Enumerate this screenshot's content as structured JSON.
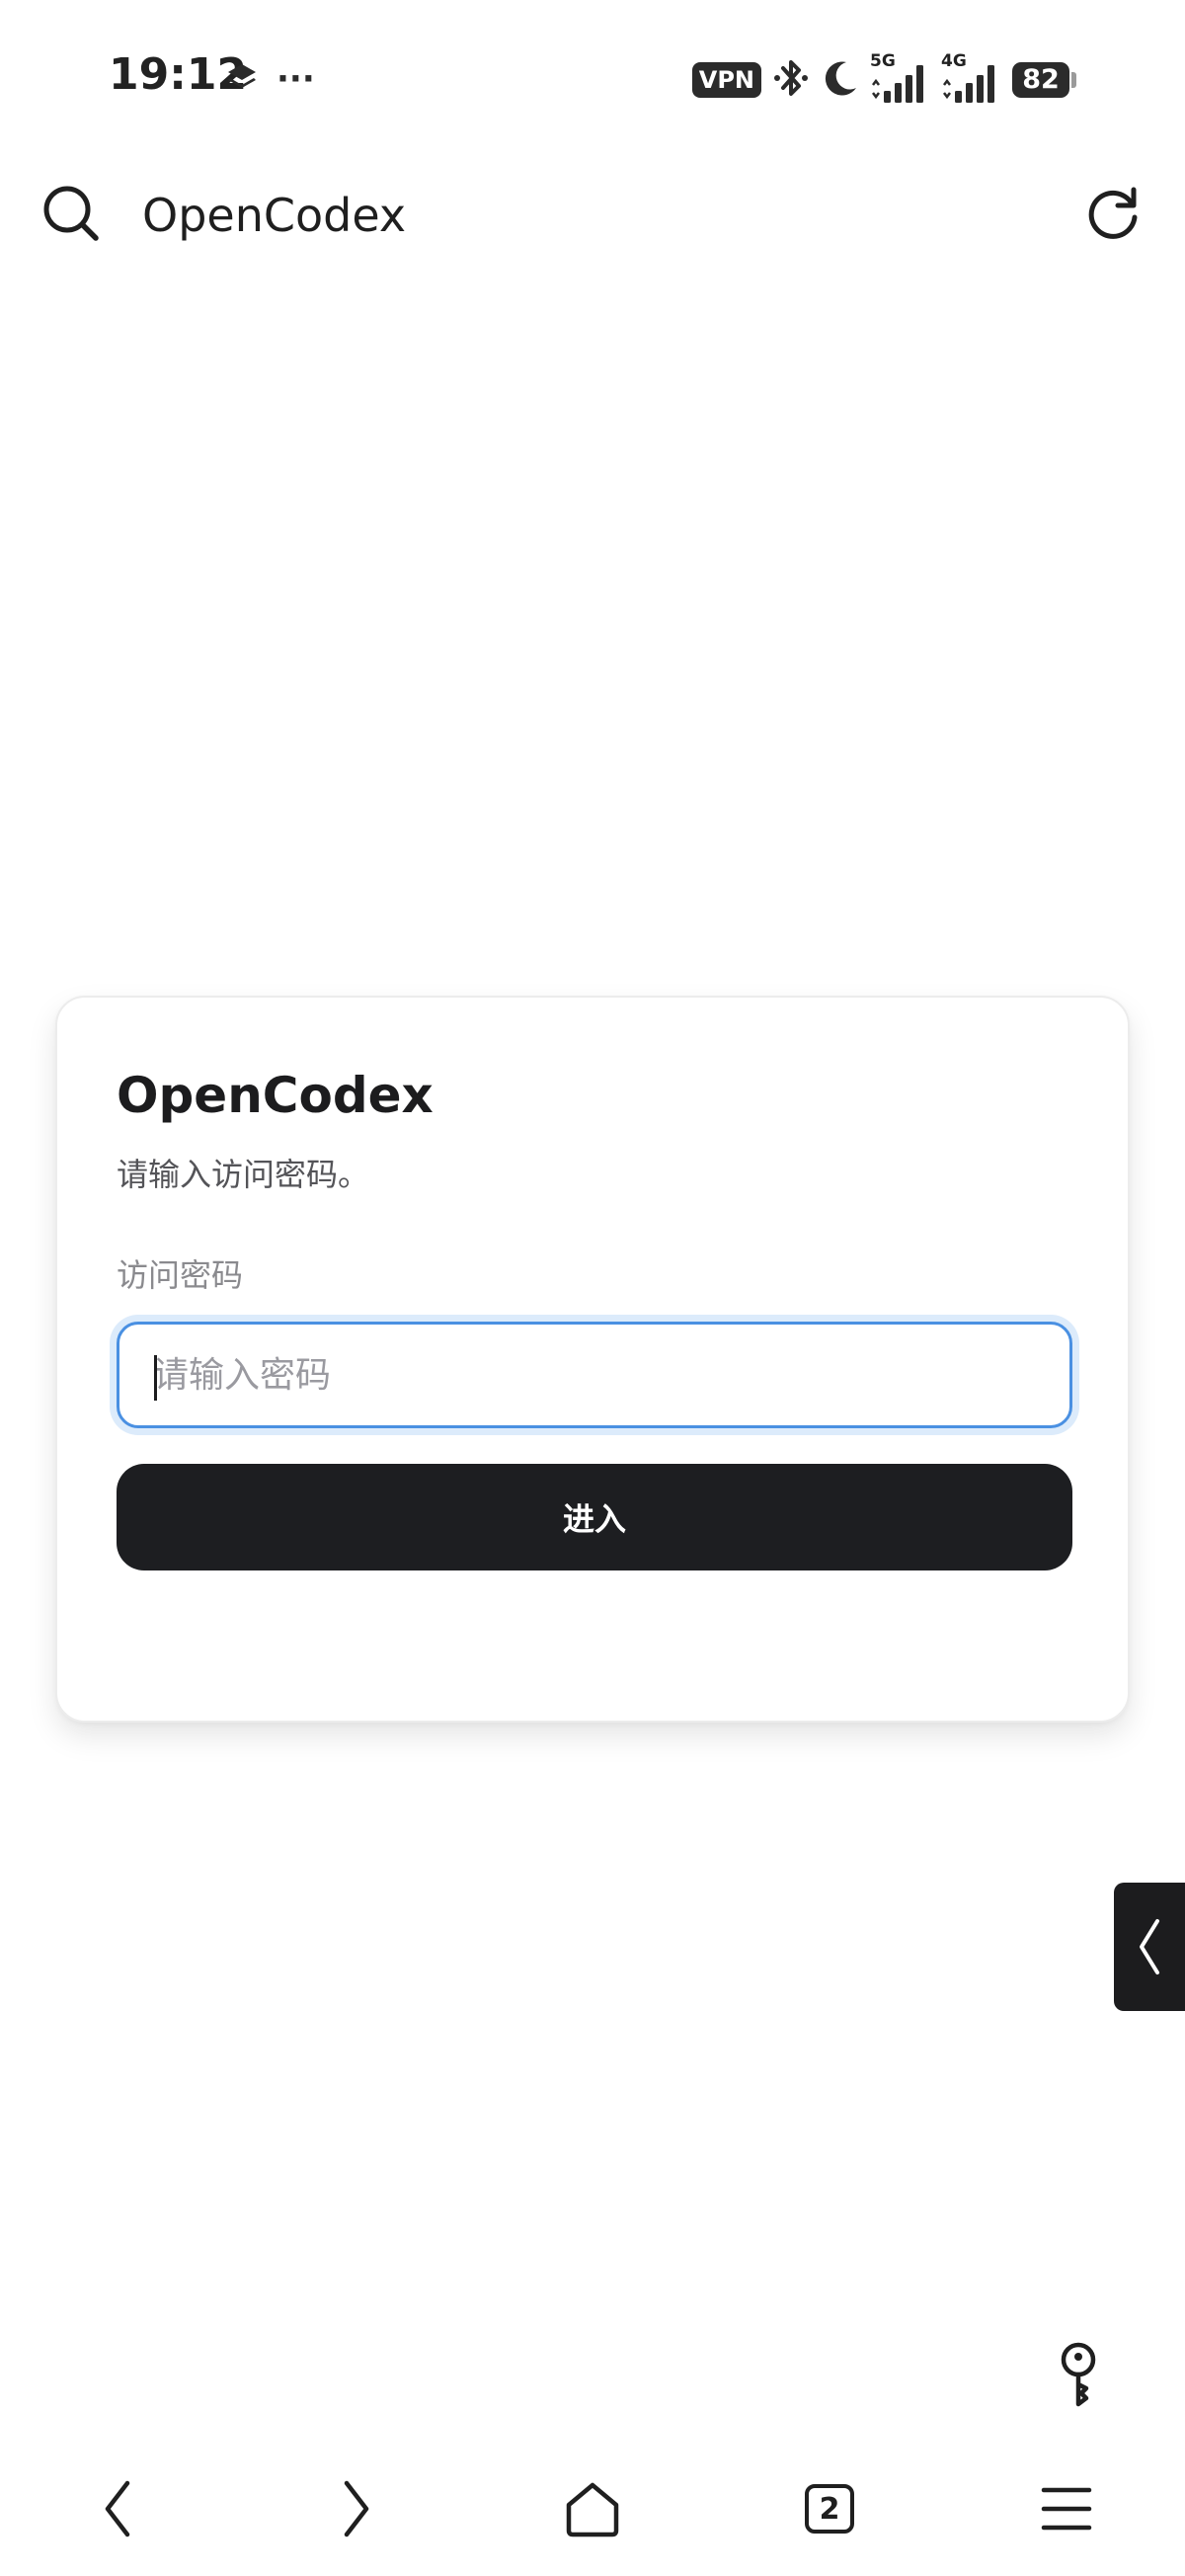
{
  "status_bar": {
    "time": "19:12",
    "overflow": "···",
    "vpn": "VPN",
    "network_1": "5G",
    "network_2": "4G",
    "battery": "82"
  },
  "browser": {
    "url_text": "OpenCodex"
  },
  "login_card": {
    "title": "OpenCodex",
    "subtitle": "请输入访问密码。",
    "field_label": "访问密码",
    "password_placeholder": "请输入密码",
    "submit_label": "进入"
  },
  "bottom_nav": {
    "tab_count": "2"
  },
  "colors": {
    "button_bg": "#1d1e21",
    "input_focus_border": "#4a90e2",
    "input_focus_ring": "#dcebfb"
  },
  "icons": [
    "layers-icon",
    "vpn-icon",
    "bluetooth-icon",
    "moon-icon",
    "signal-icon",
    "battery-icon",
    "search-icon",
    "refresh-icon",
    "chevron-left-icon",
    "key-icon",
    "back-icon",
    "forward-icon",
    "home-icon",
    "tabs-icon",
    "menu-icon"
  ]
}
